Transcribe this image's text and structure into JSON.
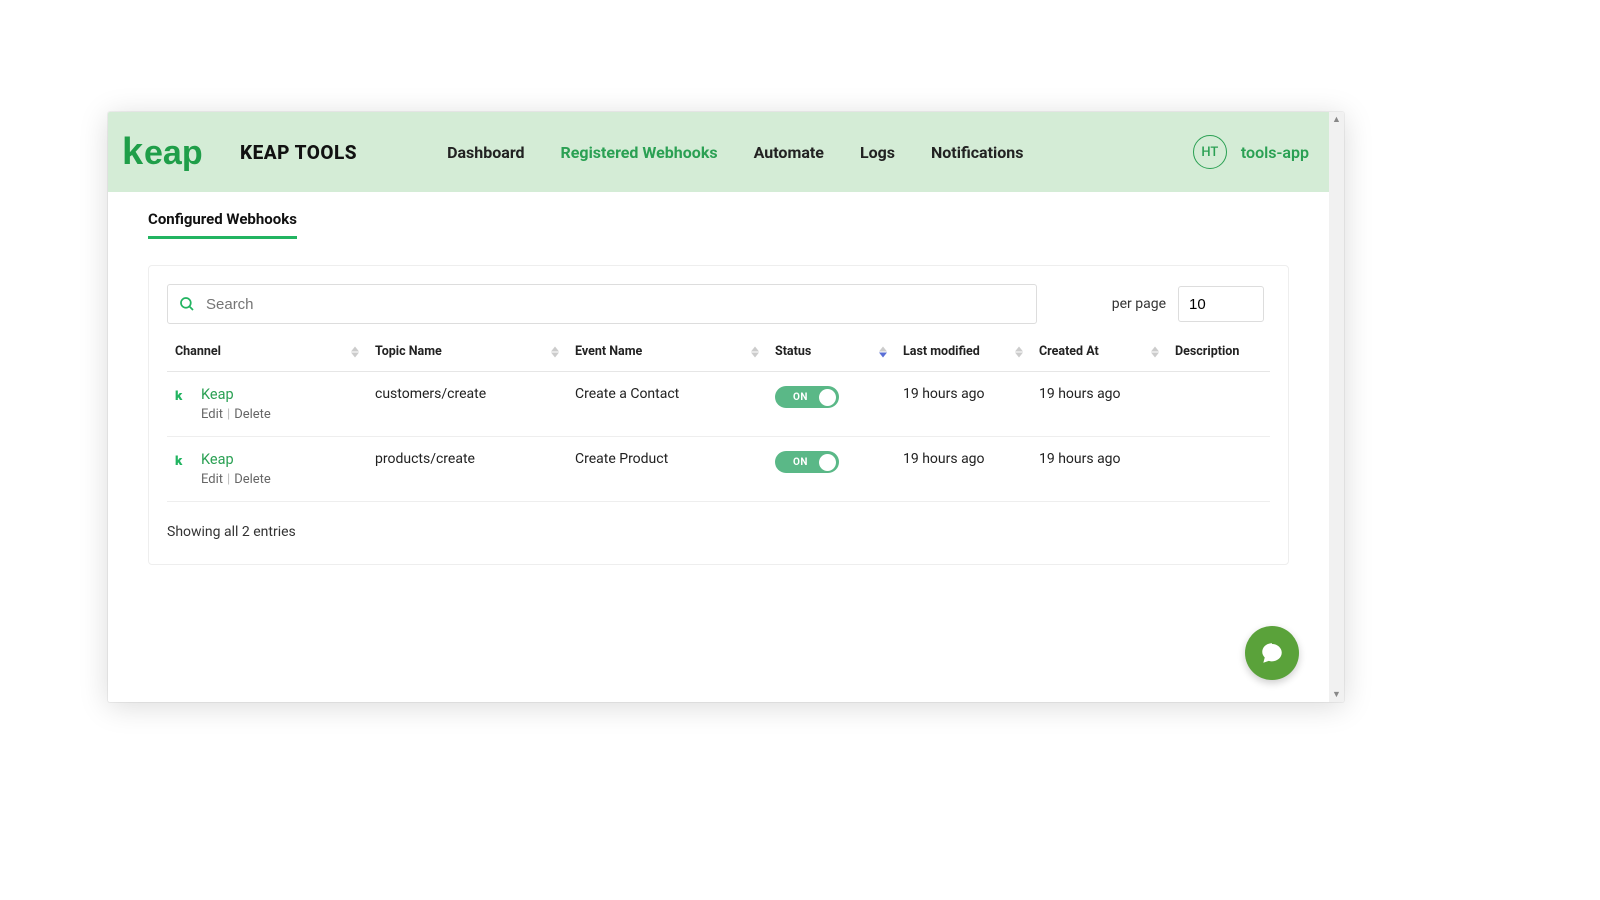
{
  "brand": {
    "name": "KEAP TOOLS"
  },
  "nav": {
    "items": [
      {
        "label": "Dashboard",
        "active": false
      },
      {
        "label": "Registered Webhooks",
        "active": true
      },
      {
        "label": "Automate",
        "active": false
      },
      {
        "label": "Logs",
        "active": false
      },
      {
        "label": "Notifications",
        "active": false
      }
    ]
  },
  "user": {
    "avatar_initials": "HT",
    "name": "tools-app"
  },
  "page": {
    "section_title": "Configured Webhooks"
  },
  "search": {
    "placeholder": "Search"
  },
  "perpage": {
    "label": "per page",
    "value": "10"
  },
  "table": {
    "headers": {
      "channel": "Channel",
      "topic": "Topic Name",
      "event": "Event Name",
      "status": "Status",
      "modified": "Last modified",
      "created": "Created At",
      "description": "Description"
    },
    "rows": [
      {
        "channel": "Keap",
        "topic": "customers/create",
        "event": "Create a Contact",
        "status": "ON",
        "modified": "19 hours ago",
        "created": "19 hours ago",
        "description": ""
      },
      {
        "channel": "Keap",
        "topic": "products/create",
        "event": "Create Product",
        "status": "ON",
        "modified": "19 hours ago",
        "created": "19 hours ago",
        "description": ""
      }
    ],
    "actions": {
      "edit": "Edit",
      "delete": "Delete"
    },
    "footer": "Showing all 2 entries"
  }
}
